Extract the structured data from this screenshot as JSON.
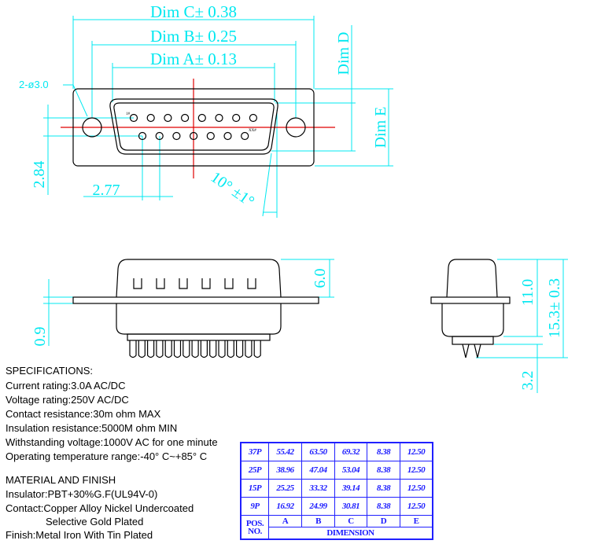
{
  "colors": {
    "dimension": "#00e8f0",
    "centerline": "#e00000",
    "outline": "#000000",
    "table": "#2020ff"
  },
  "top_view": {
    "dim_c": "Dim C± 0.38",
    "dim_b": "Dim B± 0.25",
    "dim_a": "Dim A± 0.13",
    "dim_d": "Dim D",
    "dim_e": "Dim E",
    "hole": "2-ø3.0",
    "pitch_v": "2.84",
    "pitch_h": "2.77",
    "angle": "10° ±1°",
    "pin_first": "1#",
    "pin_last": "XX#"
  },
  "side_view": {
    "shell_height": "6.0",
    "flange_thickness": "0.9"
  },
  "end_view": {
    "height": "11.0",
    "total": "15.3± 0.3",
    "tail": "3.2"
  },
  "specifications": {
    "title": "SPECIFICATIONS:",
    "lines": [
      "Current rating:3.0A AC/DC",
      "Voltage rating:250V AC/DC",
      "Contact resistance:30m ohm MAX",
      "Insulation resistance:5000M ohm MIN",
      "Withstanding voltage:1000V AC for one minute",
      "Operating temperature range:-40° C~+85° C"
    ]
  },
  "material": {
    "title": "MATERIAL AND FINISH",
    "lines": [
      "Insulator:PBT+30%G.F(UL94V-0)",
      "Contact:Copper Alloy Nickel Undercoated",
      "Selective Gold Plated",
      "Finish:Metal Iron With Tin Plated"
    ]
  },
  "dimension_table": {
    "rows": [
      [
        "37P",
        "55.42",
        "63.50",
        "69.32",
        "8.38",
        "12.50"
      ],
      [
        "25P",
        "38.96",
        "47.04",
        "53.04",
        "8.38",
        "12.50"
      ],
      [
        "15P",
        "25.25",
        "33.32",
        "39.14",
        "8.38",
        "12.50"
      ],
      [
        "9P",
        "16.92",
        "24.99",
        "30.81",
        "8.38",
        "12.50"
      ]
    ],
    "pos_label": "POS. NO.",
    "columns": [
      "A",
      "B",
      "C",
      "D",
      "E"
    ],
    "dimension_label": "DIMENSION"
  }
}
